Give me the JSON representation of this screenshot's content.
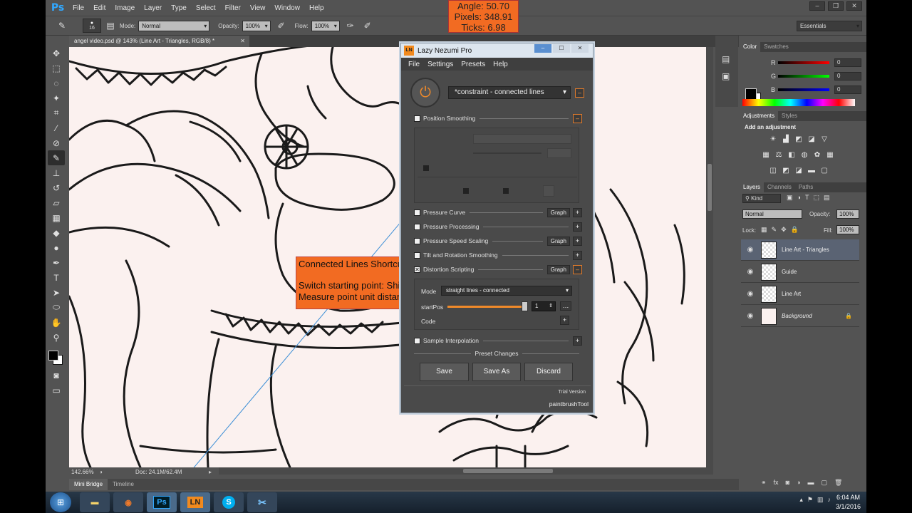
{
  "app": {
    "logo": "Ps",
    "menu": [
      "File",
      "Edit",
      "Image",
      "Layer",
      "Type",
      "Select",
      "Filter",
      "View",
      "Window",
      "Help"
    ]
  },
  "options": {
    "brush_size": "16",
    "mode_label": "Mode:",
    "mode_value": "Normal",
    "opacity_label": "Opacity:",
    "opacity_value": "100%",
    "flow_label": "Flow:",
    "flow_value": "100%",
    "workspace": "Essentials"
  },
  "overlay": {
    "angle": "Angle: 50.70",
    "pixels": "Pixels: 348.91",
    "ticks": "Ticks: 6.98"
  },
  "document": {
    "tab_title": "angel video.psd @ 143% (Line Art - Triangles, RGB/8) *",
    "zoom": "142.66%",
    "doc_size": "Doc: 24.1M/62.4M"
  },
  "bottom_tabs": [
    "Mini Bridge",
    "Timeline"
  ],
  "color_panel": {
    "tabs": [
      "Color",
      "Swatches"
    ],
    "r_label": "R",
    "r_value": "0",
    "g_label": "G",
    "g_value": "0",
    "b_label": "B",
    "b_value": "0"
  },
  "adjustments_panel": {
    "tabs": [
      "Adjustments",
      "Styles"
    ],
    "heading": "Add an adjustment"
  },
  "layers_panel": {
    "tabs": [
      "Layers",
      "Channels",
      "Paths"
    ],
    "kind": "Kind",
    "blend_mode": "Normal",
    "opacity_label": "Opacity:",
    "opacity_value": "100%",
    "lock_label": "Lock:",
    "fill_label": "Fill:",
    "fill_value": "100%",
    "layers": [
      {
        "name": "Line Art - Triangles"
      },
      {
        "name": "Guide"
      },
      {
        "name": "Line Art"
      },
      {
        "name": "Background"
      }
    ]
  },
  "lazy_nezumi": {
    "icon_text": "LN",
    "title": "Lazy Nezumi Pro",
    "menu": [
      "File",
      "Settings",
      "Presets",
      "Help"
    ],
    "preset": "*constraint - connected lines",
    "position_smoothing": "Position Smoothing",
    "pressure_curve": "Pressure Curve",
    "pressure_processing": "Pressure Processing",
    "pressure_speed_scaling": "Pressure Speed Scaling",
    "tilt_rotation": "Tilt and Rotation Smoothing",
    "distortion_scripting": "Distortion Scripting",
    "sample_interpolation": "Sample Interpolation",
    "graph_label": "Graph",
    "mode_label": "Mode",
    "mode_value": "straight lines - connected",
    "startpos_label": "startPos",
    "startpos_value": "1",
    "code_label": "Code",
    "preset_changes": "Preset Changes",
    "save": "Save",
    "save_as": "Save As",
    "discard": "Discard",
    "trial": "Trial Version",
    "tool": "paintbrushTool"
  },
  "callout": {
    "title": "Connected Lines Shortcuts",
    "line1": "Switch starting point: Shift",
    "line2": "Measure point unit distance:"
  },
  "taskbar": {
    "time": "6:04 AM",
    "date": "3/1/2016",
    "apps": [
      "Ps",
      "LN",
      "S"
    ]
  }
}
